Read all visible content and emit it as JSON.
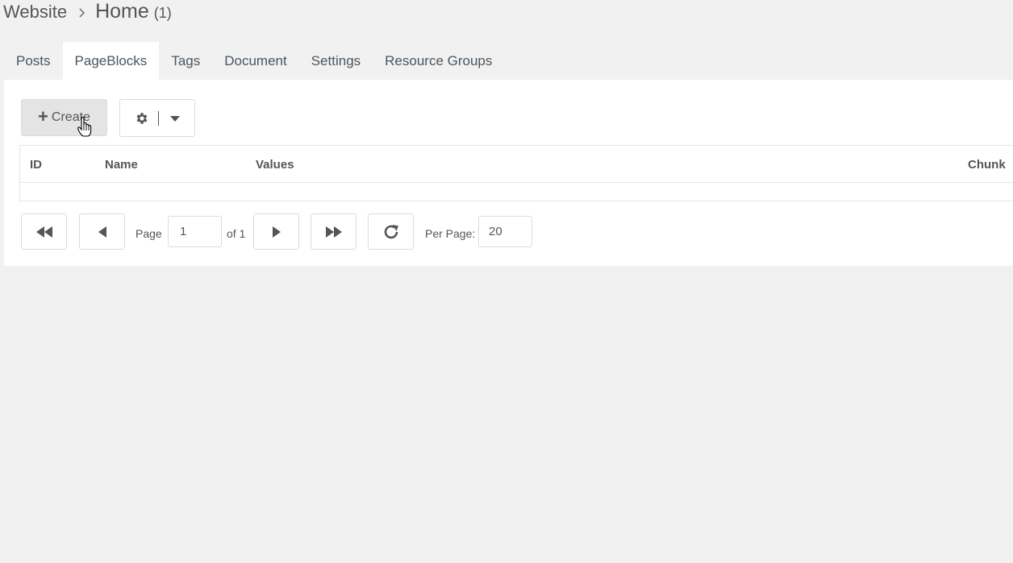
{
  "breadcrumb": {
    "parent": "Website",
    "title": "Home",
    "count": "(1)"
  },
  "tabs": [
    {
      "label": "Posts"
    },
    {
      "label": "PageBlocks",
      "active": true
    },
    {
      "label": "Tags"
    },
    {
      "label": "Document"
    },
    {
      "label": "Settings"
    },
    {
      "label": "Resource Groups"
    }
  ],
  "toolbar": {
    "create_label": "Create",
    "create_icon": "plus-icon",
    "options_icon": "gear-icon",
    "dropdown_icon": "caret-down-icon"
  },
  "grid": {
    "columns": [
      "ID",
      "Name",
      "Values",
      "Chunk"
    ],
    "rows": []
  },
  "pager": {
    "page_label": "Page",
    "page_value": "1",
    "of_label": "of 1",
    "per_page_label": "Per Page:",
    "per_page_value": "20",
    "icons": {
      "first": "double-left-icon",
      "prev": "triangle-left-icon",
      "next": "triangle-right-icon",
      "last": "double-right-icon",
      "refresh": "refresh-icon"
    }
  },
  "colors": {
    "background": "#f1f1f1",
    "panel": "#ffffff",
    "text": "#555555",
    "border": "#dcdcdc",
    "create_button": "#e4e4e4"
  }
}
